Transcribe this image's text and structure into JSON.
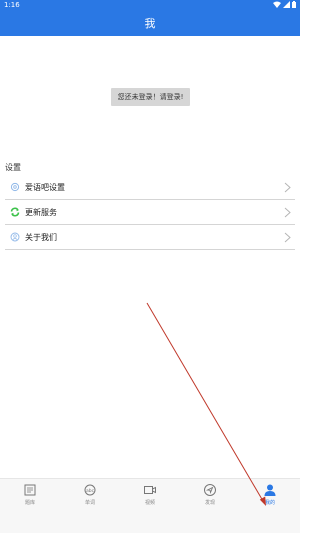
{
  "status_bar": {
    "time": "1:16"
  },
  "header": {
    "title": "我"
  },
  "login_prompt": "您还未登录！请登录!",
  "settings": {
    "title": "设置",
    "items": [
      {
        "label": "爱语吧设置",
        "icon": "gear-icon"
      },
      {
        "label": "更新服务",
        "icon": "refresh-icon"
      },
      {
        "label": "关于我们",
        "icon": "info-icon"
      }
    ]
  },
  "bottom_nav": {
    "items": [
      {
        "label": "题库",
        "icon": "question-bank-icon"
      },
      {
        "label": "单词",
        "icon": "word-icon"
      },
      {
        "label": "视频",
        "icon": "video-icon"
      },
      {
        "label": "发现",
        "icon": "discover-icon"
      },
      {
        "label": "我的",
        "icon": "profile-icon",
        "active": true
      }
    ]
  },
  "colors": {
    "primary": "#2a78e4",
    "annotation": "#c0392b",
    "divider": "#d5d5d5"
  }
}
